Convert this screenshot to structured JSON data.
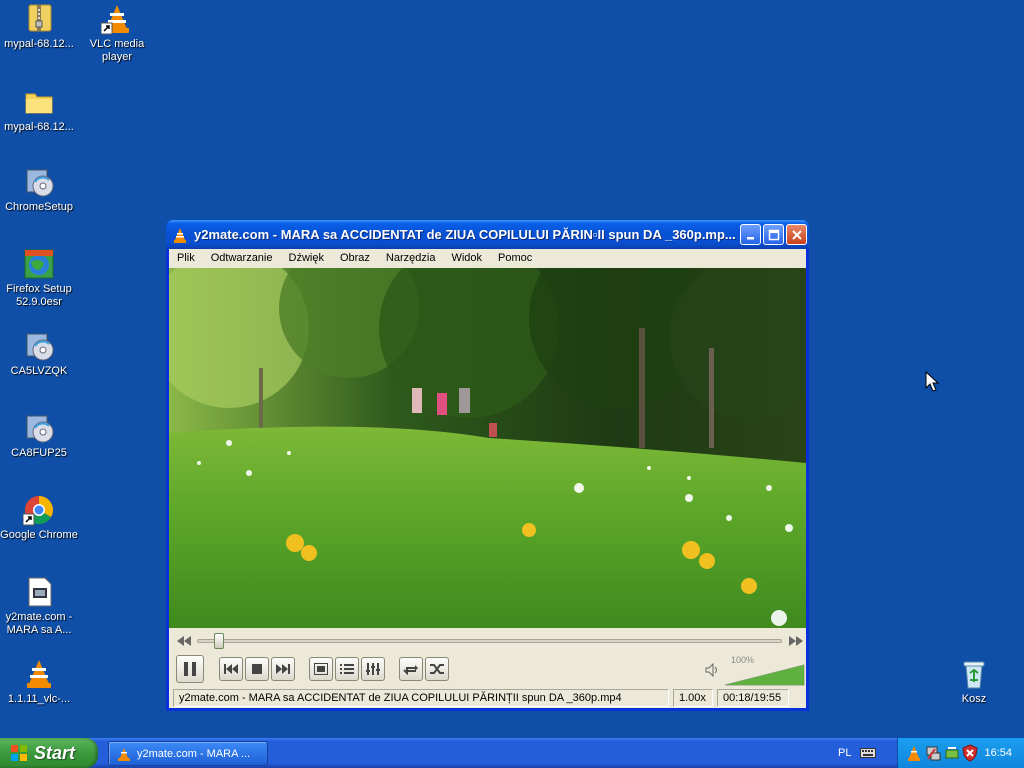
{
  "desktop": {
    "icons": [
      {
        "label": "mypal-68.12..."
      },
      {
        "label": "VLC media player"
      },
      {
        "label": "mypal-68.12..."
      },
      {
        "label": "ChromeSetup"
      },
      {
        "label": "Firefox Setup 52.9.0esr"
      },
      {
        "label": "CA5LVZQK"
      },
      {
        "label": "CA8FUP25"
      },
      {
        "label": "Google Chrome"
      },
      {
        "label": "y2mate.com - MARA sa A..."
      },
      {
        "label": "1.1.11_vlc-..."
      },
      {
        "label": "Kosz"
      }
    ]
  },
  "window": {
    "title": "y2mate.com -  MARA sa ACCIDENTAT de ZIUA COPILULUI   PĂRIN▫II spun DA _360p.mp...",
    "menu": [
      "Plik",
      "Odtwarzanie",
      "Dźwięk",
      "Obraz",
      "Narzędzia",
      "Widok",
      "Pomoc"
    ],
    "volume_label": "100%",
    "volume_level": 1.0,
    "seek_position": 0.016,
    "status": {
      "filename": "y2mate.com -  MARA sa ACCIDENTAT de ZIUA COPILULUI   PĂRINȚII spun DA _360p.mp4",
      "speed": "1.00x",
      "time": "00:18/19:55"
    }
  },
  "taskbar": {
    "start_label": "Start",
    "task_label": "y2mate.com -  MARA ...",
    "language": "PL",
    "clock": "16:54"
  },
  "colors": {
    "desktop": "#0f4fa8",
    "titlebar": "#0653d5",
    "vlc_orange": "#f28b00"
  }
}
